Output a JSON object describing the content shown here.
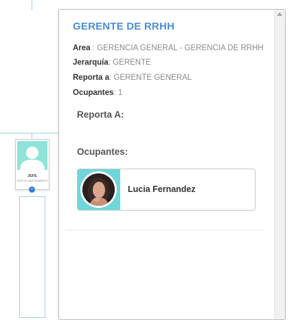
{
  "panel": {
    "title": "GERENTE DE RRHH",
    "fields": [
      {
        "label": "Area",
        "sep": " : ",
        "value": "GERENCIA GENERAL - GERENCIA DE RRHH"
      },
      {
        "label": "Jerarquía",
        "sep": ": ",
        "value": "GERENTE"
      },
      {
        "label": "Reporta a",
        "sep": ": ",
        "value": "GERENTE GENERAL"
      },
      {
        "label": "Ocupantes",
        "sep": ": ",
        "value": "1"
      }
    ],
    "reports_to_heading": "Reporta A:",
    "occupants_heading": "Ocupantes:",
    "occupants": [
      {
        "name": "Lucia Fernandez"
      }
    ]
  },
  "org_chart": {
    "node": {
      "role": "JEFE",
      "subtitle": "JEFE DE MANTENIMIENTO"
    },
    "expand_symbol": "−"
  },
  "colors": {
    "title": "#4a8ed8",
    "photo_bg": "#8fe3d8",
    "occupant_photo_bg": "#6fd6d9",
    "connector": "#9fd0ea",
    "expand_dot": "#2f7fd4"
  }
}
